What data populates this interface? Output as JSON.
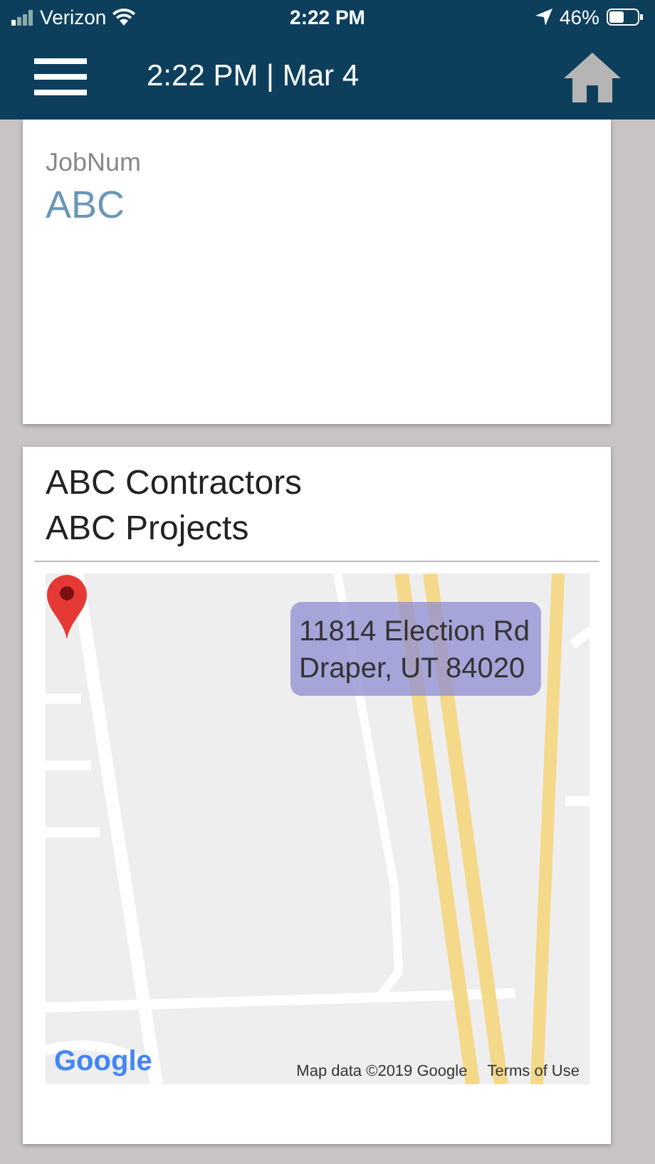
{
  "status_bar": {
    "carrier": "Verizon",
    "time": "2:22 PM",
    "battery": "46%"
  },
  "header": {
    "title": "2:22 PM | Mar 4"
  },
  "job_card": {
    "label": "JobNum",
    "value": "ABC"
  },
  "site_card": {
    "company": "ABC Contractors",
    "project": "ABC Projects",
    "map": {
      "address_line_1": "11814 Election Rd",
      "address_line_2": "Draper, UT 84020",
      "logo": "Google",
      "attribution": "Map data ©2019 Google",
      "terms": "Terms of Use"
    }
  }
}
